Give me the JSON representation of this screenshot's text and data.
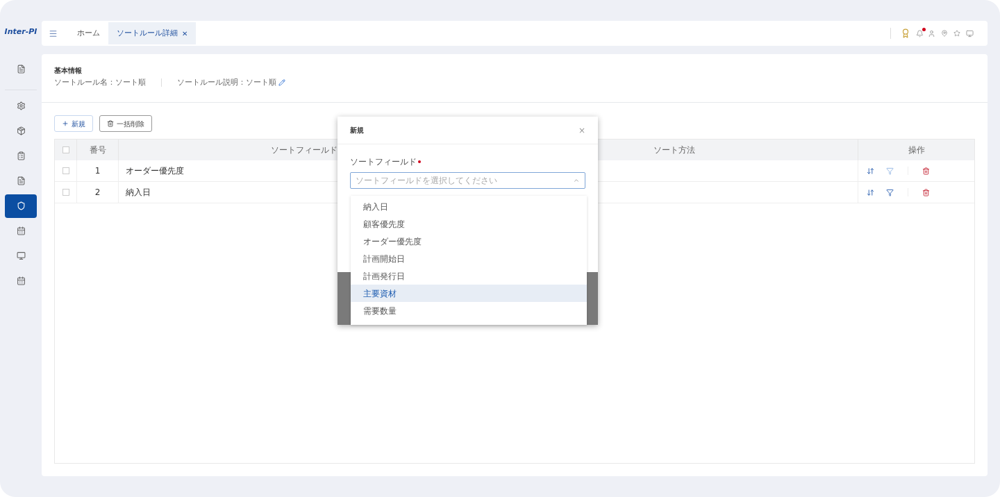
{
  "app": {
    "logo": "Inter-PI"
  },
  "sidebar": {
    "items": [
      {
        "selected": false
      },
      {
        "selected": false
      },
      {
        "selected": false
      },
      {
        "selected": false
      },
      {
        "selected": false
      },
      {
        "selected": true
      },
      {
        "selected": false
      },
      {
        "selected": false
      },
      {
        "selected": false
      }
    ]
  },
  "tabs": [
    {
      "label": "ホーム",
      "selected": false
    },
    {
      "label": "ソートルール詳細",
      "selected": true,
      "close": "✕"
    }
  ],
  "header": {
    "notification_dot": true
  },
  "info": {
    "title": "基本情報",
    "fields": [
      {
        "label": "ソートルール名：",
        "value": "ソート順",
        "editable": false
      },
      {
        "label": "ソートルール説明：",
        "value": "ソート順",
        "editable": true
      }
    ]
  },
  "toolbar": {
    "buttons": [
      {
        "kind": "add",
        "label": "新規"
      },
      {
        "kind": "delete",
        "label": "一括削除"
      }
    ]
  },
  "table": {
    "all_checked": false,
    "columns": [
      "番号",
      "ソートフィールド",
      "ソート方法",
      "操作"
    ],
    "rows": [
      {
        "checked": false,
        "number": "1",
        "field": "オーダー優先度",
        "filter_active": false
      },
      {
        "checked": false,
        "number": "2",
        "field": "納入日",
        "filter_active": true
      }
    ]
  },
  "dialog": {
    "title": "新規",
    "close": "×",
    "field_label": "ソートフィールド",
    "required": true,
    "placeholder": "ソートフィールドを選択してください",
    "expanded": true,
    "options": [
      {
        "label": "納入日",
        "selected": false
      },
      {
        "label": "顧客優先度",
        "selected": false
      },
      {
        "label": "オーダー優先度",
        "selected": false
      },
      {
        "label": "計画開始日",
        "selected": false
      },
      {
        "label": "計画発行日",
        "selected": false
      },
      {
        "label": "主要資材",
        "selected": true
      },
      {
        "label": "需要数量",
        "selected": false
      }
    ]
  }
}
